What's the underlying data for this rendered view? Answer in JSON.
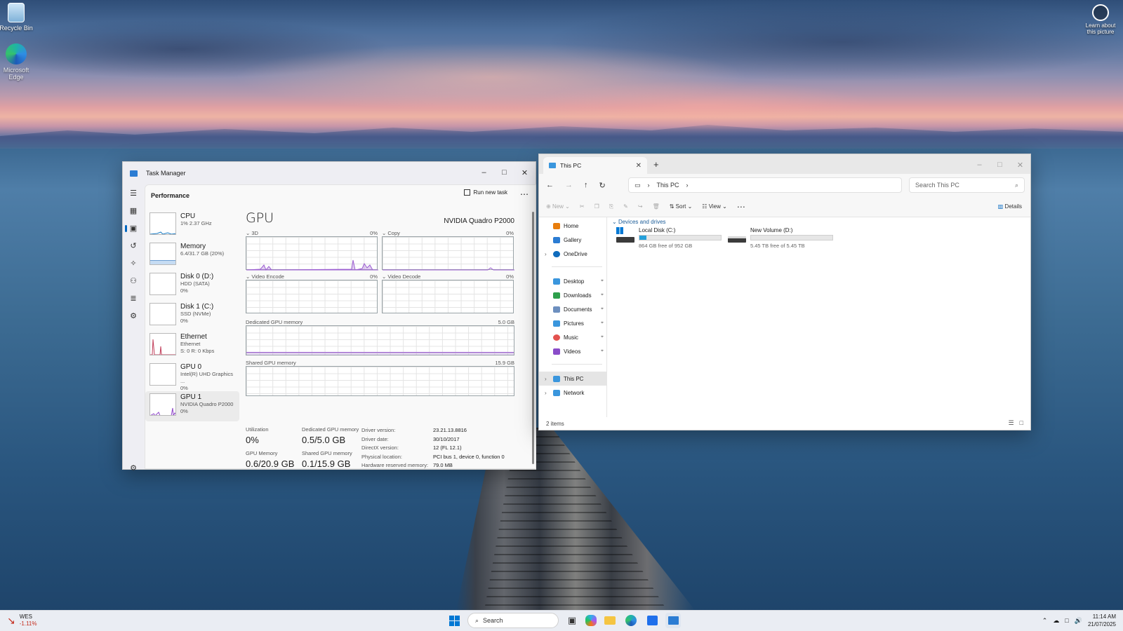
{
  "desktop": {
    "icons": [
      {
        "label": "Recycle Bin",
        "icon": "recycle-bin-icon"
      },
      {
        "label": "Microsoft Edge",
        "icon": "edge-icon"
      }
    ],
    "learn_label": "Learn about this picture"
  },
  "task_manager": {
    "title": "Task Manager",
    "section": "Performance",
    "run_new_task": "Run new task",
    "items": [
      {
        "name": "CPU",
        "sub1": "1% 2.37 GHz",
        "sub2": ""
      },
      {
        "name": "Memory",
        "sub1": "6.4/31.7 GB (20%)",
        "sub2": ""
      },
      {
        "name": "Disk 0 (D:)",
        "sub1": "HDD (SATA)",
        "sub2": "0%"
      },
      {
        "name": "Disk 1 (C:)",
        "sub1": "SSD (NVMe)",
        "sub2": "0%"
      },
      {
        "name": "Ethernet",
        "sub1": "Ethernet",
        "sub2": "S: 0 R: 0 Kbps"
      },
      {
        "name": "GPU 0",
        "sub1": "Intel(R) UHD Graphics ...",
        "sub2": "0%"
      },
      {
        "name": "GPU 1",
        "sub1": "NVIDIA Quadro P2000",
        "sub2": "0%"
      }
    ],
    "gpu": {
      "title": "GPU",
      "model": "NVIDIA Quadro P2000",
      "engines": [
        {
          "label": "3D",
          "pct": "0%"
        },
        {
          "label": "Copy",
          "pct": "0%"
        },
        {
          "label": "Video Encode",
          "pct": "0%"
        },
        {
          "label": "Video Decode",
          "pct": "0%"
        }
      ],
      "dedicated_label": "Dedicated GPU memory",
      "dedicated_max": "5.0 GB",
      "shared_label": "Shared GPU memory",
      "shared_max": "15.9 GB",
      "stats": {
        "utilization_label": "Utilization",
        "utilization": "0%",
        "dedicated_label": "Dedicated GPU memory",
        "dedicated": "0.5/5.0 GB",
        "gpu_memory_label": "GPU Memory",
        "gpu_memory": "0.6/20.9 GB",
        "shared_label": "Shared GPU memory",
        "shared": "0.1/15.9 GB"
      },
      "driver": [
        {
          "k": "Driver version:",
          "v": "23.21.13.8816"
        },
        {
          "k": "Driver date:",
          "v": "30/10/2017"
        },
        {
          "k": "DirectX version:",
          "v": "12 (FL 12.1)"
        },
        {
          "k": "Physical location:",
          "v": "PCI bus 1, device 0, function 0"
        },
        {
          "k": "Hardware reserved memory:",
          "v": "79.0 MB"
        }
      ]
    }
  },
  "explorer": {
    "tab_title": "This PC",
    "breadcrumb": "This PC",
    "search_placeholder": "Search This PC",
    "cmd": {
      "new": "New",
      "sort": "Sort",
      "view": "View",
      "details": "Details"
    },
    "nav": [
      {
        "label": "Home",
        "color": "#e87d0d"
      },
      {
        "label": "Gallery",
        "color": "#2b7cd3"
      },
      {
        "label": "OneDrive",
        "color": "#0f6cbd"
      }
    ],
    "quick": [
      {
        "label": "Desktop",
        "color": "#3a96dd"
      },
      {
        "label": "Downloads",
        "color": "#2e9f4c"
      },
      {
        "label": "Documents",
        "color": "#6d8fbf"
      },
      {
        "label": "Pictures",
        "color": "#3a96dd"
      },
      {
        "label": "Music",
        "color": "#e3524f"
      },
      {
        "label": "Videos",
        "color": "#8a4cc9"
      }
    ],
    "bottom_nav": [
      {
        "label": "This PC",
        "color": "#3a96dd"
      },
      {
        "label": "Network",
        "color": "#3a96dd"
      }
    ],
    "group": "Devices and drives",
    "drives": [
      {
        "name": "Local Disk (C:)",
        "free": "864 GB free of 952 GB",
        "used_fraction": 0.09
      },
      {
        "name": "New Volume (D:)",
        "free": "5.45 TB free of 5.45 TB",
        "used_fraction": 0.0
      }
    ],
    "status": "2 items"
  },
  "taskbar": {
    "weather_name": "WES",
    "weather_change": "-1.11%",
    "search": "Search",
    "time": "11:14 AM",
    "date": "21/07/2025"
  }
}
